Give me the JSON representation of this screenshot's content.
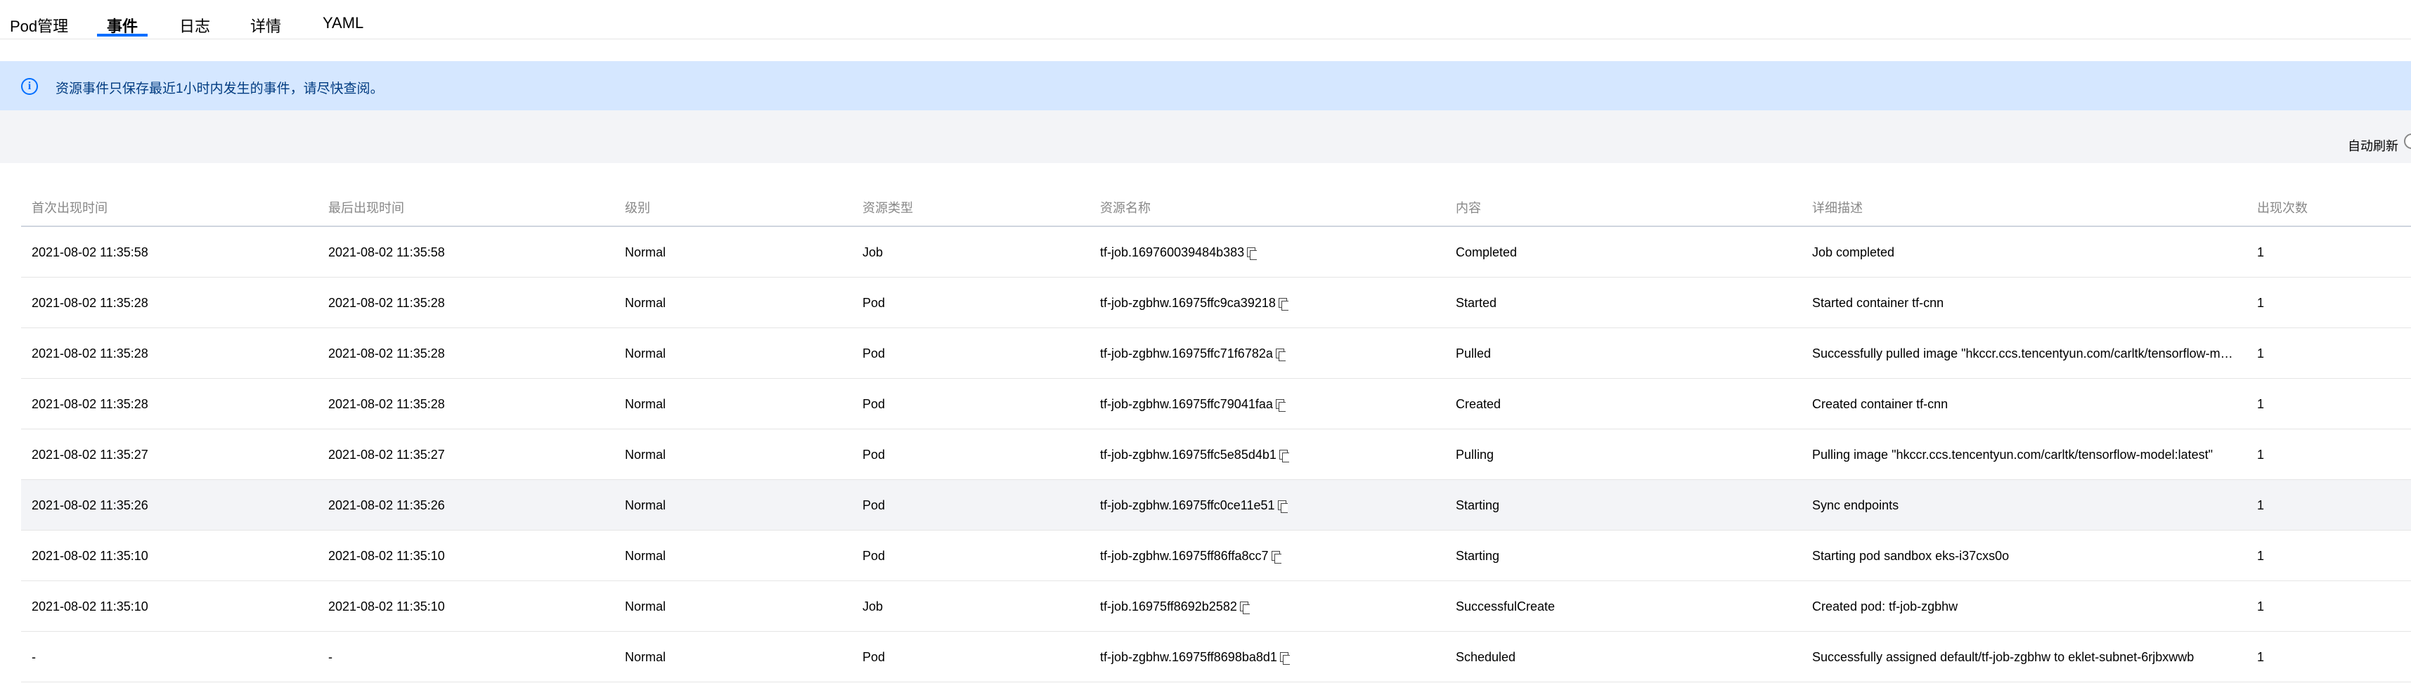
{
  "tabs": [
    {
      "label": "Pod管理"
    },
    {
      "label": "事件"
    },
    {
      "label": "日志"
    },
    {
      "label": "详情"
    },
    {
      "label": "YAML"
    }
  ],
  "active_tab": "事件",
  "notice": {
    "text": "资源事件只保存最近1小时内发生的事件，请尽快查阅。"
  },
  "toolbar": {
    "auto_refresh_label": "自动刷新"
  },
  "table": {
    "columns": [
      "首次出现时间",
      "最后出现时间",
      "级别",
      "资源类型",
      "资源名称",
      "内容",
      "详细描述",
      "出现次数"
    ],
    "rows": [
      {
        "first": "2021-08-02 11:35:58",
        "last": "2021-08-02 11:35:58",
        "level": "Normal",
        "type": "Job",
        "name": "tf-job.169760039484b383",
        "content": "Completed",
        "detail": "Job completed",
        "count": "1"
      },
      {
        "first": "2021-08-02 11:35:28",
        "last": "2021-08-02 11:35:28",
        "level": "Normal",
        "type": "Pod",
        "name": "tf-job-zgbhw.16975ffc9ca39218",
        "content": "Started",
        "detail": "Started container tf-cnn",
        "count": "1"
      },
      {
        "first": "2021-08-02 11:35:28",
        "last": "2021-08-02 11:35:28",
        "level": "Normal",
        "type": "Pod",
        "name": "tf-job-zgbhw.16975ffc71f6782a",
        "content": "Pulled",
        "detail": "Successfully pulled image \"hkccr.ccs.tencentyun.com/carltk/tensorflow-model:latest\"",
        "count": "1"
      },
      {
        "first": "2021-08-02 11:35:28",
        "last": "2021-08-02 11:35:28",
        "level": "Normal",
        "type": "Pod",
        "name": "tf-job-zgbhw.16975ffc79041faa",
        "content": "Created",
        "detail": "Created container tf-cnn",
        "count": "1"
      },
      {
        "first": "2021-08-02 11:35:27",
        "last": "2021-08-02 11:35:27",
        "level": "Normal",
        "type": "Pod",
        "name": "tf-job-zgbhw.16975ffc5e85d4b1",
        "content": "Pulling",
        "detail": "Pulling image \"hkccr.ccs.tencentyun.com/carltk/tensorflow-model:latest\"",
        "count": "1"
      },
      {
        "first": "2021-08-02 11:35:26",
        "last": "2021-08-02 11:35:26",
        "level": "Normal",
        "type": "Pod",
        "name": "tf-job-zgbhw.16975ffc0ce11e51",
        "content": "Starting",
        "detail": "Sync endpoints",
        "count": "1"
      },
      {
        "first": "2021-08-02 11:35:10",
        "last": "2021-08-02 11:35:10",
        "level": "Normal",
        "type": "Pod",
        "name": "tf-job-zgbhw.16975ff86ffa8cc7",
        "content": "Starting",
        "detail": "Starting pod sandbox eks-i37cxs0o",
        "count": "1"
      },
      {
        "first": "2021-08-02 11:35:10",
        "last": "2021-08-02 11:35:10",
        "level": "Normal",
        "type": "Job",
        "name": "tf-job.16975ff8692b2582",
        "content": "SuccessfulCreate",
        "detail": "Created pod: tf-job-zgbhw",
        "count": "1"
      },
      {
        "first": "-",
        "last": "-",
        "level": "Normal",
        "type": "Pod",
        "name": "tf-job-zgbhw.16975ff8698ba8d1",
        "content": "Scheduled",
        "detail": "Successfully assigned default/tf-job-zgbhw to eklet-subnet-6rjbxwwb",
        "count": "1"
      }
    ]
  },
  "colors": {
    "accent": "#006eff",
    "notice_bg": "#d5e7ff",
    "toolbar_bg": "#f3f4f7"
  }
}
